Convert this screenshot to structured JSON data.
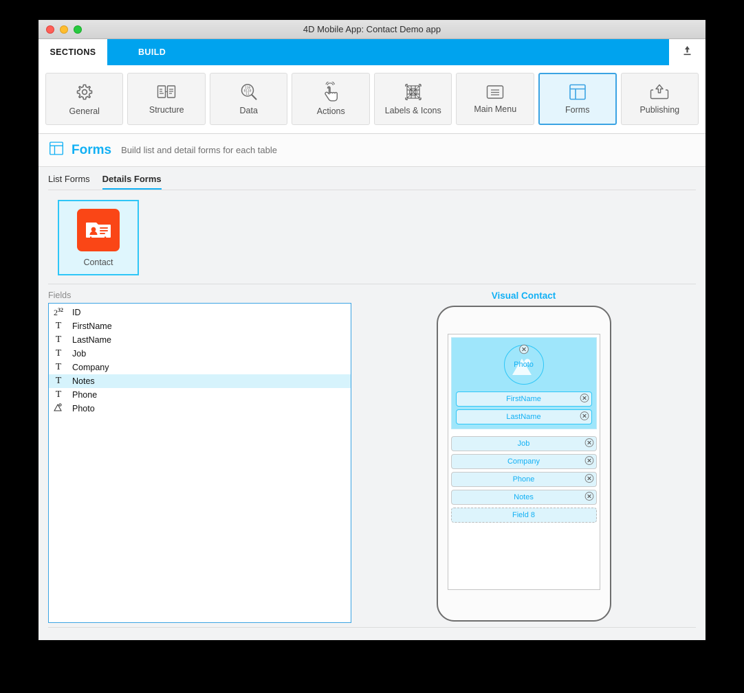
{
  "window": {
    "title": "4D Mobile App: Contact Demo app",
    "traffic_lights": [
      "close-button",
      "minimize-button",
      "zoom-button"
    ]
  },
  "tabs": {
    "sections_label": "SECTIONS",
    "build_label": "BUILD",
    "export_icon": "upload-icon",
    "active_color": "#00a3ee"
  },
  "toolbar": {
    "items": [
      {
        "label": "General",
        "icon": "gear-icon",
        "active": false
      },
      {
        "label": "Structure",
        "icon": "structure-icon",
        "active": false
      },
      {
        "label": "Data",
        "icon": "data-search-icon",
        "active": false
      },
      {
        "label": "Actions",
        "icon": "tap-hand-icon",
        "active": false
      },
      {
        "label": "Labels & Icons",
        "icon": "grid-icons-icon",
        "active": false
      },
      {
        "label": "Main Menu",
        "icon": "menu-list-icon",
        "active": false
      },
      {
        "label": "Forms",
        "icon": "forms-layout-icon",
        "active": true
      },
      {
        "label": "Publishing",
        "icon": "upload-box-icon",
        "active": false
      }
    ]
  },
  "section": {
    "icon": "forms-layout-icon",
    "title": "Forms",
    "subtitle": "Build list and detail forms for each table",
    "title_color": "#12b0f4"
  },
  "subtabs": [
    {
      "label": "List Forms",
      "active": false
    },
    {
      "label": "Details Forms",
      "active": true
    }
  ],
  "tables": [
    {
      "label": "Contact",
      "icon": "contact-card-icon",
      "selected": true,
      "icon_color": "#fa4616"
    }
  ],
  "fields_panel": {
    "label": "Fields",
    "items": [
      {
        "name": "ID",
        "type_icon": "integer-icon",
        "selected": false
      },
      {
        "name": "FirstName",
        "type_icon": "text-icon",
        "selected": false
      },
      {
        "name": "LastName",
        "type_icon": "text-icon",
        "selected": false
      },
      {
        "name": "Job",
        "type_icon": "text-icon",
        "selected": false
      },
      {
        "name": "Company",
        "type_icon": "text-icon",
        "selected": false
      },
      {
        "name": "Notes",
        "type_icon": "text-icon",
        "selected": true
      },
      {
        "name": "Phone",
        "type_icon": "text-icon",
        "selected": false
      },
      {
        "name": "Photo",
        "type_icon": "image-icon",
        "selected": false
      }
    ]
  },
  "preview": {
    "title": "Visual Contact",
    "header": {
      "photo_label": "Photo",
      "photo_icon": "image-placeholder-icon",
      "photo_delete_icon": "delete-circle-icon",
      "fields": [
        {
          "label": "FirstName",
          "delete_icon": "delete-circle-icon",
          "style": "highlight"
        },
        {
          "label": "LastName",
          "delete_icon": "delete-circle-icon",
          "style": "highlight"
        }
      ]
    },
    "body_fields": [
      {
        "label": "Job",
        "delete_icon": "delete-circle-icon",
        "style": "plain"
      },
      {
        "label": "Company",
        "delete_icon": "delete-circle-icon",
        "style": "plain"
      },
      {
        "label": "Phone",
        "delete_icon": "delete-circle-icon",
        "style": "plain"
      },
      {
        "label": "Notes",
        "delete_icon": "delete-circle-icon",
        "style": "plain"
      },
      {
        "label": "Field 8",
        "delete_icon": null,
        "style": "ghost"
      }
    ]
  }
}
